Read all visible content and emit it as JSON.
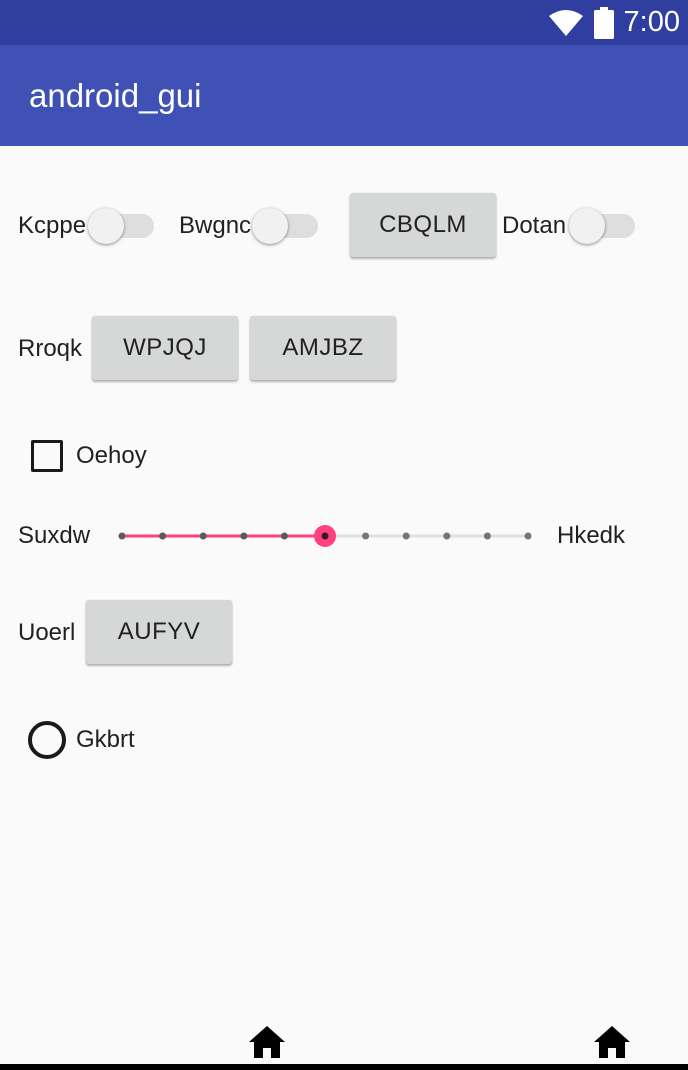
{
  "status_bar": {
    "time": "7:00",
    "icons": [
      "wifi-icon",
      "battery-icon"
    ]
  },
  "app_bar": {
    "title": "android_gui"
  },
  "row1": {
    "switch1_label": "Kcppe",
    "switch2_label": "Bwgnc",
    "button_label": "CBQLM",
    "switch3_label": "Dotan"
  },
  "row2": {
    "label": "Rroqk",
    "button1_label": "WPJQJ",
    "button2_label": "AMJBZ"
  },
  "checkbox": {
    "label": "Oehoy",
    "checked": false
  },
  "slider": {
    "min_label": "Suxdw",
    "max_label": "Hkedk",
    "steps": 10,
    "value": 5,
    "accent": "#ff4081"
  },
  "row5": {
    "label": "Uoerl",
    "button_label": "AUFYV"
  },
  "radio": {
    "label": "Gkbrt",
    "checked": false
  },
  "colors": {
    "status_bar": "#303f9f",
    "app_bar": "#3f51b5",
    "accent": "#ff4081",
    "background": "#fafafa"
  }
}
